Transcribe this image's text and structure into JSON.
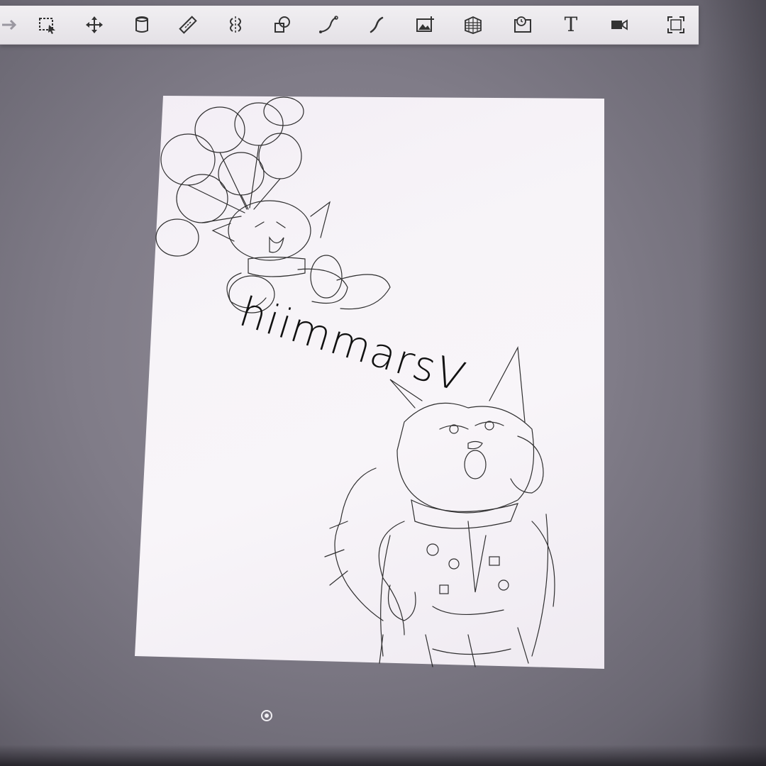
{
  "toolbar": {
    "tools": [
      {
        "name": "arrow-icon"
      },
      {
        "name": "selection-icon"
      },
      {
        "name": "move-icon"
      },
      {
        "name": "fill-icon"
      },
      {
        "name": "ruler-icon"
      },
      {
        "name": "symmetry-icon"
      },
      {
        "name": "shape-icon"
      },
      {
        "name": "curve-icon"
      },
      {
        "name": "stroke-icon"
      },
      {
        "name": "image-import-icon"
      },
      {
        "name": "perspective-grid-icon"
      },
      {
        "name": "timelapse-icon"
      },
      {
        "name": "text-icon",
        "glyph": "T"
      },
      {
        "name": "video-icon"
      },
      {
        "name": "fullscreen-icon"
      }
    ]
  },
  "watermark": {
    "text": "hiimmarsV"
  },
  "colors": {
    "toolbar_bg": "#ebe8ec",
    "icon": "#333333",
    "paper": "#f6f3f7",
    "ink": "#1a1a1a"
  }
}
